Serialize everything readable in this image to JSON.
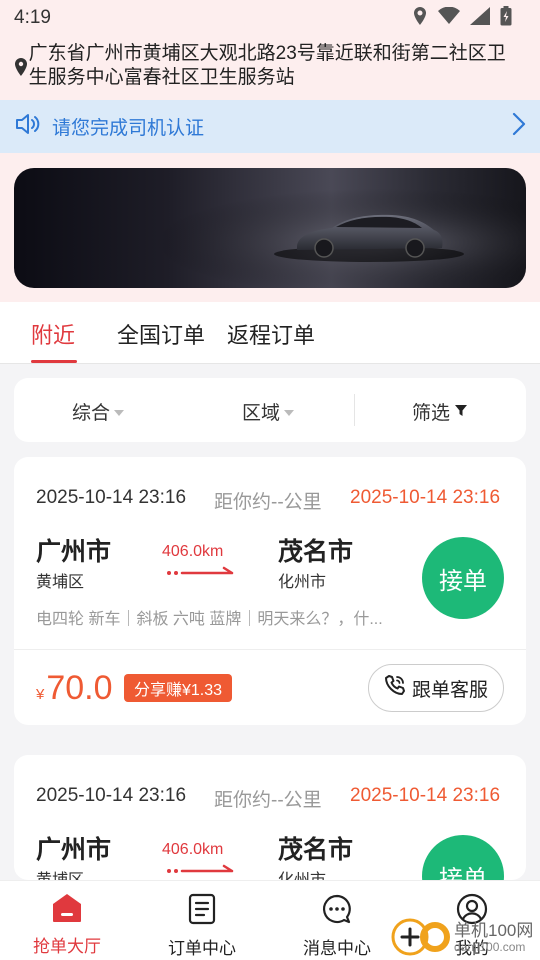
{
  "status_bar": {
    "time": "4:19"
  },
  "location": {
    "text": "广东省广州市黄埔区大观北路23号靠近联和街第二社区卫生服务中心富春社区卫生服务站"
  },
  "notice": {
    "text": "请您完成司机认证"
  },
  "tabs": [
    {
      "label": "附近"
    },
    {
      "label": "全国订单"
    },
    {
      "label": "返程订单"
    }
  ],
  "filters": [
    {
      "label": "综合"
    },
    {
      "label": "区域"
    },
    {
      "label": "筛选"
    }
  ],
  "orders": [
    {
      "time": "2025-10-14 23:16",
      "distance_text": "距你约--公里",
      "time2": "2025-10-14 23:16",
      "from_city": "广州市",
      "from_district": "黄埔区",
      "km": "406.0km",
      "to_city": "茂名市",
      "to_district": "化州市",
      "accept_label": "接单",
      "tags": "电四轮 新车｜斜板 六吨 蓝牌｜明天来么？，什...",
      "currency": "¥",
      "price": "70.0",
      "share_label": "分享赚¥1.33",
      "service_label": "跟单客服"
    },
    {
      "time": "2025-10-14 23:16",
      "distance_text": "距你约--公里",
      "time2": "2025-10-14 23:16",
      "from_city": "广州市",
      "from_district": "黄埔区",
      "km": "406.0km",
      "to_city": "茂名市",
      "to_district": "化州市",
      "accept_label": "接单"
    }
  ],
  "bottom_nav": [
    {
      "label": "抢单大厅",
      "icon": "home-icon"
    },
    {
      "label": "订单中心",
      "icon": "document-icon"
    },
    {
      "label": "消息中心",
      "icon": "chat-icon"
    },
    {
      "label": "我的",
      "icon": "user-icon"
    }
  ],
  "watermark": {
    "line1": "单机100网",
    "line2": "danji100.com"
  },
  "colors": {
    "accent": "#e0393e",
    "accept": "#1db978",
    "price": "#ef5a33",
    "notice": "#2f79d6"
  }
}
